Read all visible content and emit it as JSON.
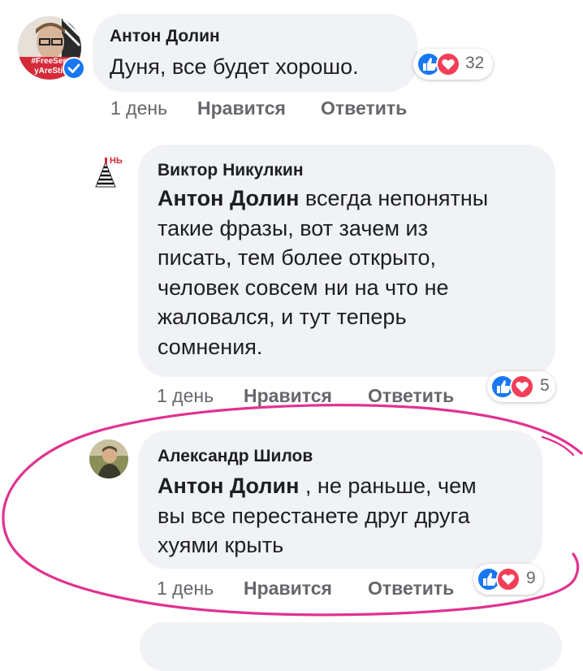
{
  "comments": [
    {
      "author": "Антон Долин",
      "text": "Дуня, все будет хорошо.",
      "time": "1 день",
      "like": "Нравится",
      "reply": "Ответить",
      "reactions": "32",
      "avatar_badge_line1": "#FreeSen",
      "avatar_badge_line2": "yAreStil"
    },
    {
      "author": "Виктор Никулкин",
      "mention": "Антон Долин",
      "text_lines": [
        " всегда непонятны",
        "такие фразы, вот зачем из",
        "писать, тем более открыто,",
        "человек совсем ни на что не",
        "жаловался, и тут теперь",
        "сомнения."
      ],
      "time": "1 день",
      "like": "Нравится",
      "reply": "Ответить",
      "reactions": "5",
      "avatar_badge": "НЬ"
    },
    {
      "author": "Александр Шилов",
      "mention": "Антон Долин",
      "text_lines": [
        " , не раньше, чем",
        "вы все перестанете друг друга",
        "хуями крыть"
      ],
      "time": "1 день",
      "like": "Нравится",
      "reply": "Ответить",
      "reactions": "9"
    }
  ],
  "colors": {
    "bubble": "#f0f2f5",
    "like_blue": "#1877f2",
    "love_red": "#f33e58",
    "annotation": "#e0338f",
    "verified": "#1877f2"
  }
}
